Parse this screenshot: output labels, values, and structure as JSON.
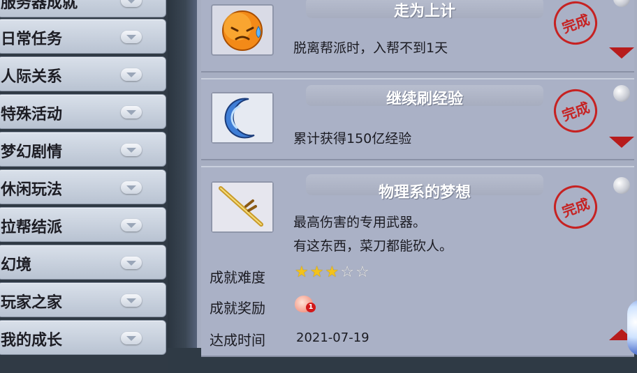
{
  "sidebar": {
    "items": [
      {
        "label": "服务器成就"
      },
      {
        "label": "日常任务"
      },
      {
        "label": "人际关系"
      },
      {
        "label": "特殊活动"
      },
      {
        "label": "梦幻剧情"
      },
      {
        "label": "休闲玩法"
      },
      {
        "label": "拉帮结派"
      },
      {
        "label": "幻境"
      },
      {
        "label": "玩家之家"
      },
      {
        "label": "我的成长"
      }
    ]
  },
  "achievements": [
    {
      "title": "走为上计",
      "desc": "脱离帮派时，入帮不到1天",
      "icon": "sweating-face-icon",
      "stamp": "完成"
    },
    {
      "title": "继续刷经验",
      "desc": "累计获得150亿经验",
      "icon": "crescent-moon-icon",
      "stamp": "完成"
    },
    {
      "title": "物理系的梦想",
      "desc1": "最高伤害的专用武器。",
      "desc2": "有这东西，菜刀都能砍人。",
      "icon": "golden-sword-icon",
      "stamp": "完成"
    }
  ],
  "detail": {
    "difficulty_label": "成就难度",
    "reward_label": "成就奖励",
    "time_label": "达成时间",
    "time_value": "2021-07-19",
    "difficulty_stars": 3,
    "difficulty_max": 5,
    "reward_icon": "peach-icon",
    "reward_count": "1"
  },
  "colors": {
    "stamp_red": "#c62222",
    "star": "#f3c21a",
    "arrow": "#b71c1c"
  }
}
